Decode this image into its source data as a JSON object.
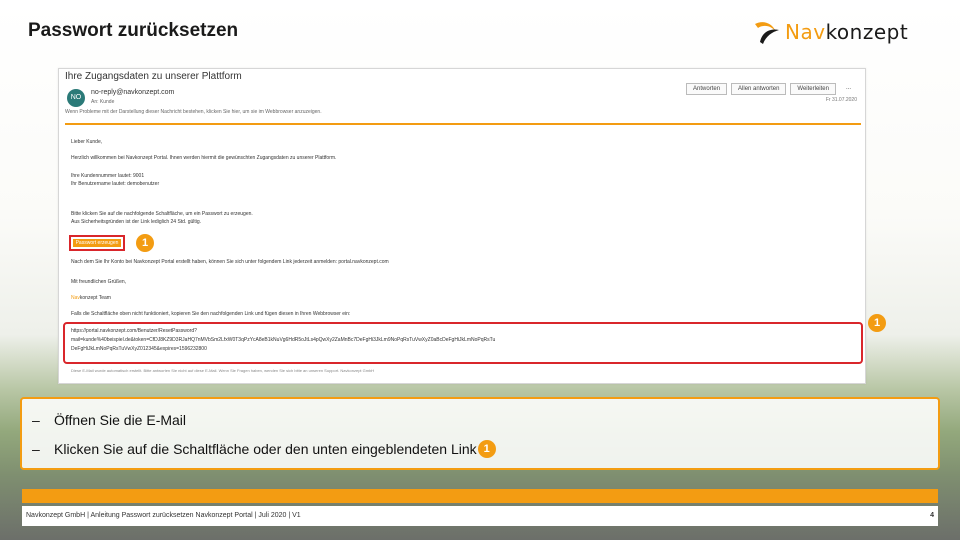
{
  "slide": {
    "title": "Passwort zurücksetzen"
  },
  "logo": {
    "part1": "Nav",
    "part2": "konzept",
    "accent_color": "#f39c12"
  },
  "email": {
    "subject": "Ihre Zugangsdaten zu unserer Plattform",
    "avatar_initials": "NO",
    "sender": "no-reply@navkonzept.com",
    "recipient": "An: Kunde",
    "actions": [
      "Antworten",
      "Allen antworten",
      "Weiterleiten",
      "..."
    ],
    "date": "Fr 31.07.2020",
    "info_bar": "Wenn Probleme mit der Darstellung dieser Nachricht bestehen, klicken Sie hier, um sie im Webbrowser anzuzeigen.",
    "greeting": "Lieber Kunde,",
    "welcome": "Herzlich willkommen bei Navkonzept Portal. Ihnen werden hiermit die gewünschten Zugangsdaten zu unserer Plattform.",
    "customer_number": "Ihre Kundennummer lautet: 9001",
    "username": "Ihr Benutzername lautet: demobenutzer",
    "instruction_1": "Bitte klicken Sie auf die nachfolgende Schaltfläche, um ein Passwort zu erzeugen.",
    "instruction_2": "Aus Sicherheitsgründen ist der Link lediglich 24 Std. gültig.",
    "reset_button": "Passwort erzeugen",
    "questions": "Nach dem Sie Ihr Konto bei Navkonzept Portal erstellt haben, können Sie sich unter folgendem Link jederzeit anmelden: portal.navkonzept.com",
    "regards": "Mit freundlichen Grüßen,",
    "brand_sign_accent": "Nav",
    "brand_sign_rest": "konzept Team",
    "link_hint": "Falls die Schaltfläche oben nicht funktioniert, kopieren Sie den nachfolgenden Link und fügen diesen in Ihren Webbrowser ein:",
    "link_line1": "https://portal.navkonzept.com/Benutzer/ResetPassword?",
    "link_line2": "mail=kunde%40beispiel.de&token=CfDJ8KZ9D3RJaHQ7nMVbSm2LfxW0T3qPzYcA8eB1kNuVg6HdR5oJtLs4pQwXy2ZaMnBc7DeFgHi3JkLm9NoPqRsTuVwXyZ0aBcDeFgHiJkLmNoPqRsTu",
    "link_line3": "DeFgHiJkLmNoPqRsTuVwXyZ012345&expires=1596232800",
    "footer_note": "Diese E-Mail wurde automatisch erstellt. Bitte antworten Sie nicht auf diese E-Mail. Wenn Sie Fragen haben, wenden Sie sich bitte an unseren Support. Navkonzept GmbH",
    "markers": [
      "1",
      "1"
    ]
  },
  "instructions": {
    "dash": "–",
    "step1": "Öffnen Sie die E-Mail",
    "step2": "Klicken Sie auf die Schaltfläche oder den unten eingeblendeten Link",
    "marker": "1"
  },
  "footer": {
    "text": "Navkonzept GmbH  |  Anleitung Passwort zurücksetzen Navkonzept Portal  |  Juli 2020  |  V1",
    "page_number": "4"
  }
}
